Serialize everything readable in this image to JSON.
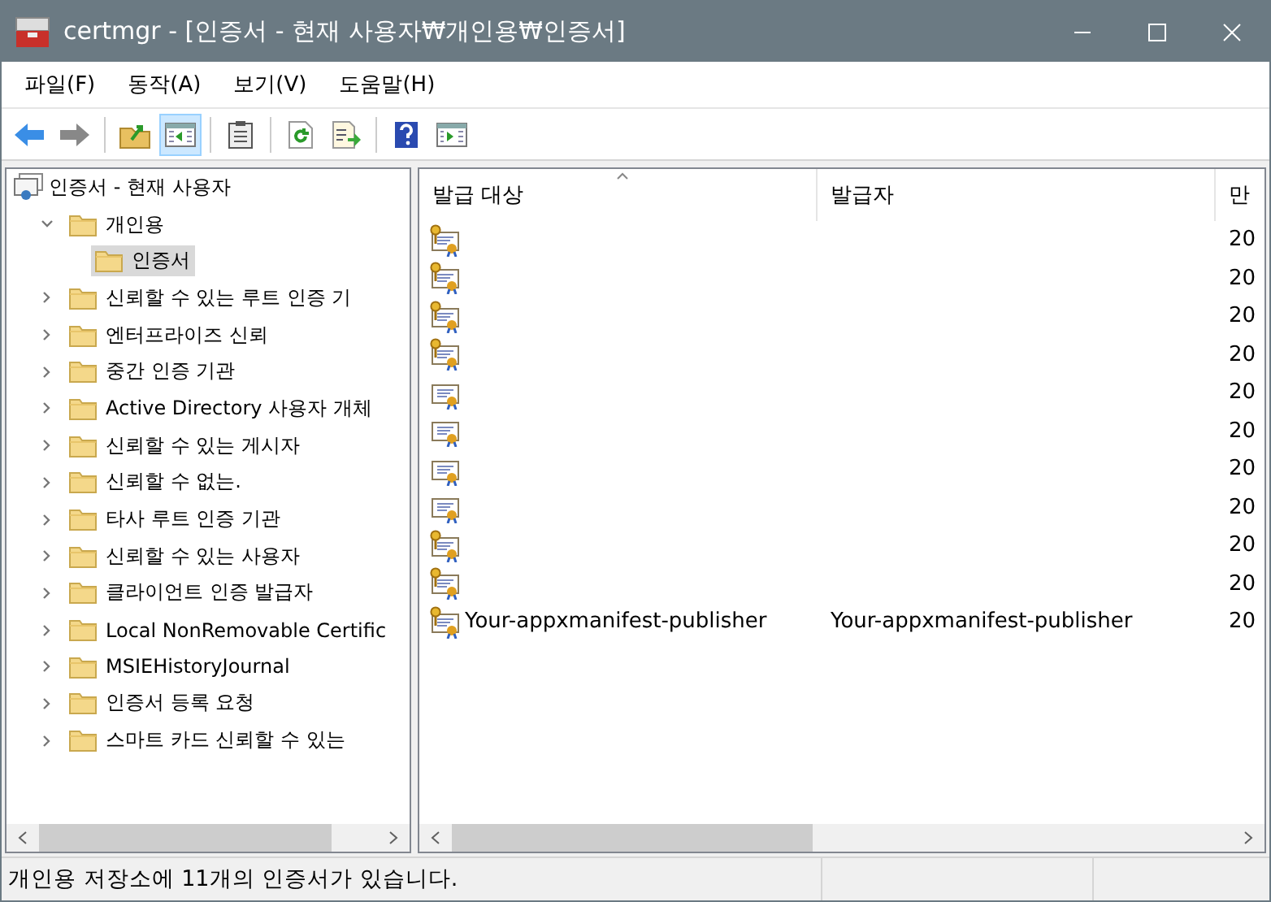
{
  "window": {
    "title": "certmgr - [인증서 - 현재 사용자₩개인용₩인증서]"
  },
  "menu": [
    "파일(F)",
    "동작(A)",
    "보기(V)",
    "도움말(H)"
  ],
  "toolbar": [
    [
      {
        "kind": "back",
        "selected": false
      },
      {
        "kind": "forward",
        "selected": false
      }
    ],
    [
      {
        "kind": "up",
        "selected": false
      },
      {
        "kind": "tree",
        "selected": true
      }
    ],
    [
      {
        "kind": "list",
        "selected": false
      }
    ],
    [
      {
        "kind": "refresh",
        "selected": false
      },
      {
        "kind": "export",
        "selected": false
      }
    ],
    [
      {
        "kind": "help",
        "selected": false
      },
      {
        "kind": "pane",
        "selected": false
      }
    ]
  ],
  "tree": {
    "label": "인증서 - 현재 사용자",
    "children": [
      {
        "label": "개인용",
        "expanded": true,
        "selected": false,
        "children": [
          {
            "label": "인증서",
            "selected": true
          }
        ]
      },
      {
        "label": "신뢰할 수 있는 루트 인증 기",
        "expanded": false,
        "selected": false
      },
      {
        "label": "엔터프라이즈 신뢰",
        "expanded": false,
        "selected": false
      },
      {
        "label": "중간 인증 기관",
        "expanded": false,
        "selected": false
      },
      {
        "label": "Active Directory 사용자 개체",
        "expanded": false,
        "selected": false
      },
      {
        "label": "신뢰할 수 있는 게시자",
        "expanded": false,
        "selected": false
      },
      {
        "label": "신뢰할 수 없는.",
        "expanded": false,
        "selected": false
      },
      {
        "label": "타사 루트 인증 기관",
        "expanded": false,
        "selected": false
      },
      {
        "label": "신뢰할 수 있는 사용자",
        "expanded": false,
        "selected": false
      },
      {
        "label": "클라이언트 인증 발급자",
        "expanded": false,
        "selected": false
      },
      {
        "label": "Local NonRemovable Certific",
        "expanded": false,
        "selected": false
      },
      {
        "label": "MSIEHistoryJournal",
        "expanded": false,
        "selected": false
      },
      {
        "label": "인증서 등록 요청",
        "expanded": false,
        "selected": false
      },
      {
        "label": "스마트 카드 신뢰할 수 있는",
        "expanded": false,
        "selected": false
      }
    ]
  },
  "table": {
    "columns": [
      "발급 대상",
      "발급자",
      "만"
    ],
    "rows": [
      {
        "kind": "key",
        "cells": [
          "",
          "",
          "20"
        ]
      },
      {
        "kind": "key",
        "cells": [
          "",
          "",
          "20"
        ]
      },
      {
        "kind": "key",
        "cells": [
          "",
          "",
          "20"
        ]
      },
      {
        "kind": "key",
        "cells": [
          "",
          "",
          "20"
        ]
      },
      {
        "kind": "plain",
        "cells": [
          "",
          "",
          "20"
        ]
      },
      {
        "kind": "plain",
        "cells": [
          "",
          "",
          "20"
        ]
      },
      {
        "kind": "plain",
        "cells": [
          "",
          "",
          "20"
        ]
      },
      {
        "kind": "plain",
        "cells": [
          "",
          "",
          "20"
        ]
      },
      {
        "kind": "key",
        "cells": [
          "",
          "",
          "20"
        ]
      },
      {
        "kind": "key",
        "cells": [
          "",
          "",
          "20"
        ]
      },
      {
        "kind": "key",
        "cells": [
          "Your-appxmanifest-publisher",
          "Your-appxmanifest-publisher",
          "20"
        ]
      }
    ]
  },
  "status_bar": "개인용 저장소에 11개의 인증서가 있습니다."
}
